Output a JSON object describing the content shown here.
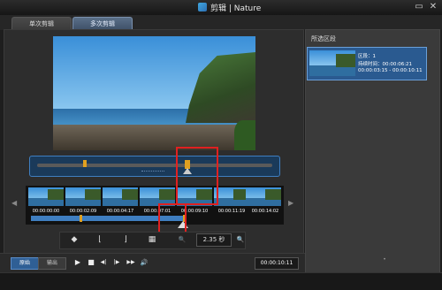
{
  "window": {
    "title": "剪辑 | Nature",
    "minimize_glyph": "▭",
    "close_glyph": "✕"
  },
  "tabs": [
    {
      "label": "单次剪辑",
      "active": false
    },
    {
      "label": "多次剪辑",
      "active": true
    }
  ],
  "filmstrip": {
    "timecodes": [
      "00:00:00:00",
      "00:00:02:09",
      "00:00:04:17",
      "00:00:07:01",
      "00:00:09:10",
      "00:00:11:19",
      "00:00:14:02"
    ],
    "nav_left": "◀",
    "nav_right": "▶"
  },
  "tools": {
    "prev_icon": "◆",
    "mark_in_icon": "⌊",
    "mark_out_icon": "⌋",
    "frames_icon": "▦",
    "zoom_out_icon": "🔍",
    "zoom_value": "2.35 秒",
    "zoom_in_icon": "🔍"
  },
  "bottom": {
    "original_label": "原始",
    "output_label": "输出",
    "play": "▶",
    "stop": "■",
    "prev_frame": "◀|",
    "next_frame": "|▶",
    "fast_forward": "▶▶",
    "volume": "🔊",
    "time": "00:00:10:11"
  },
  "right_panel": {
    "header": "所选区段",
    "segment": {
      "line1": "区段：1",
      "line2": "持续时间：00:00:06:21",
      "line3": "00:00:03:15 - 00:00:10:11"
    },
    "dots": "•"
  },
  "status": {
    "text": ""
  },
  "colors": {
    "accent": "#3f7ec0",
    "marker": "#e0a020",
    "annotation": "#e02020"
  }
}
